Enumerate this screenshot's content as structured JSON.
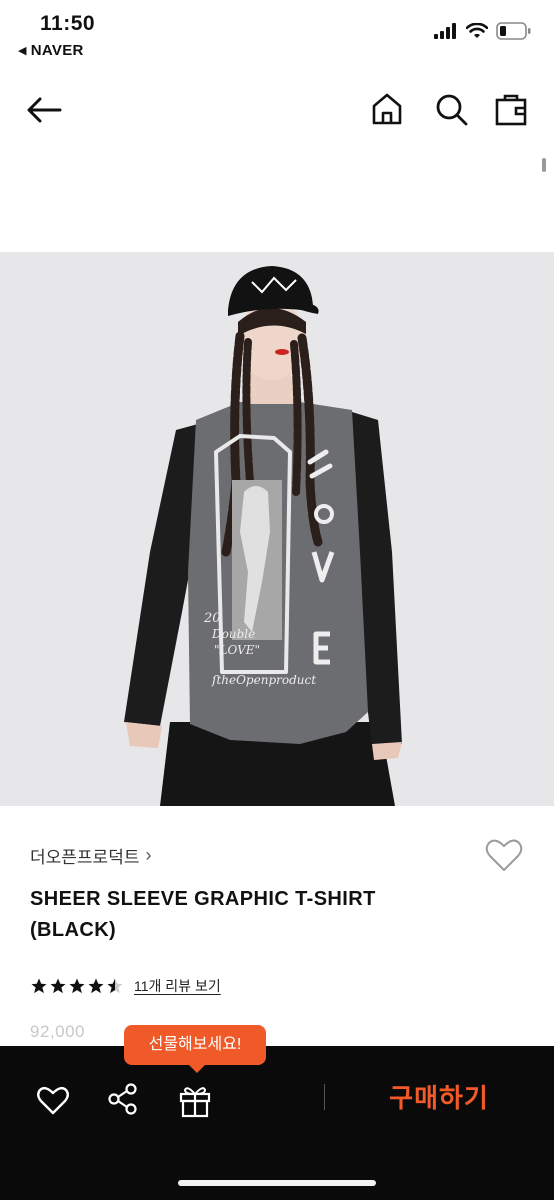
{
  "status": {
    "time": "11:50",
    "back_app": "NAVER",
    "battery_level": 0.2
  },
  "nav": {
    "back_icon": "arrow-left-icon",
    "home_icon": "home-icon",
    "search_icon": "search-icon",
    "bag_icon": "shopping-bag-icon"
  },
  "product": {
    "brand": "더오픈프로덕트",
    "brand_chevron": "›",
    "title": "SHEER SLEEVE GRAPHIC T-SHIRT (BLACK)",
    "rating": 4.5,
    "review_link": "11개 리뷰 보기",
    "price": "92,000",
    "image_caption": "ſtheOpenproduct"
  },
  "bottom_bar": {
    "gift_tooltip": "선물해보세요!",
    "buy_label": "구매하기",
    "accent_color": "#f35a28"
  }
}
